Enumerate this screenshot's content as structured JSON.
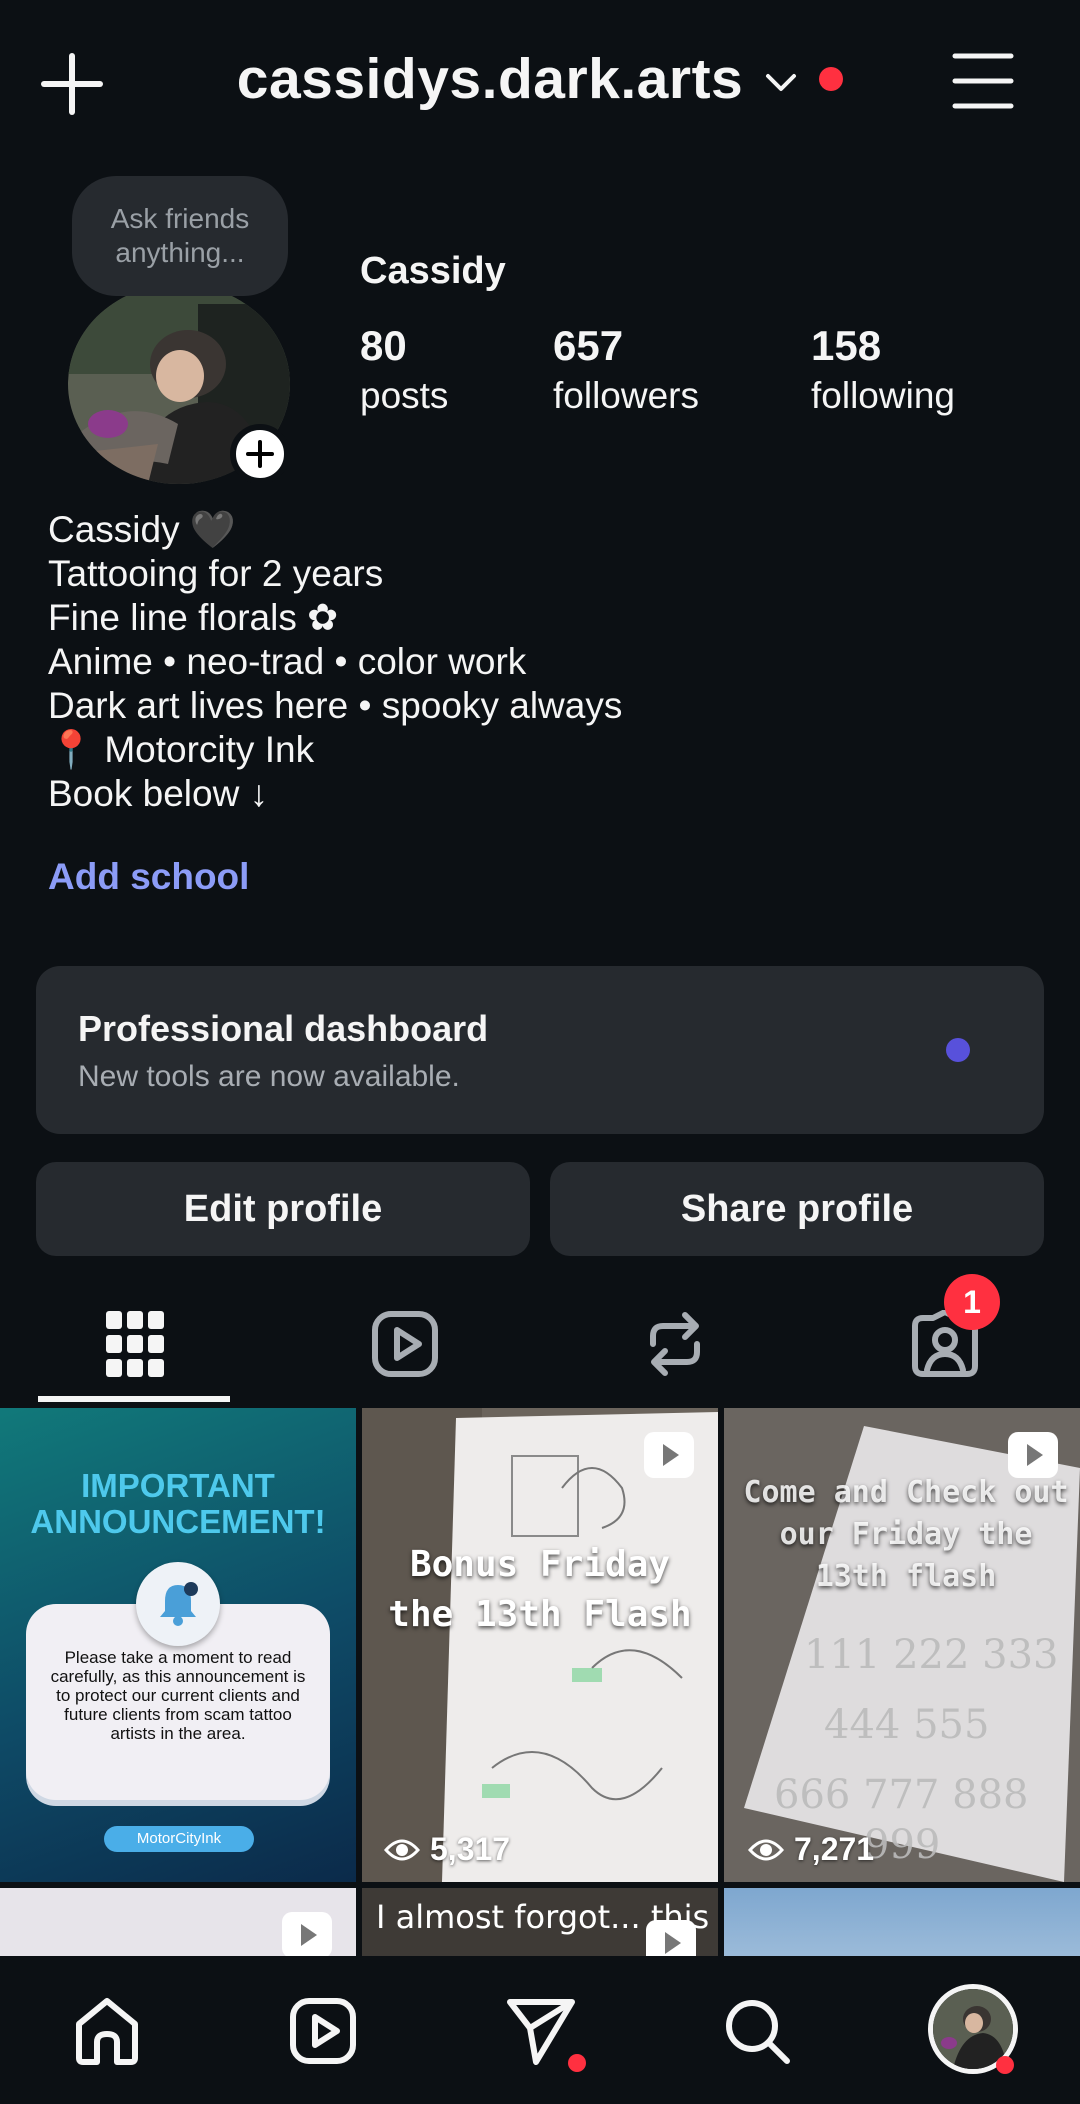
{
  "header": {
    "username": "cassidys.dark.arts"
  },
  "note": {
    "text": "Ask friends anything..."
  },
  "profile": {
    "display_name": "Cassidy",
    "stats": [
      {
        "value": "80",
        "label": "posts"
      },
      {
        "value": "657",
        "label": "followers"
      },
      {
        "value": "158",
        "label": "following"
      }
    ],
    "bio": [
      "Cassidy 🖤",
      "Tattooing for 2 years",
      "Fine line florals ✿",
      "Anime • neo-trad • color work",
      "Dark art lives here • spooky always",
      "📍 Motorcity Ink",
      "Book below ↓"
    ],
    "add_school": "Add school"
  },
  "dashboard": {
    "title": "Professional dashboard",
    "subtitle": "New tools are now available."
  },
  "actions": {
    "edit": "Edit profile",
    "share": "Share profile"
  },
  "tabs": {
    "tagged_badge": "1"
  },
  "posts": [
    {
      "heading": "IMPORTANT ANNOUNCEMENT!",
      "body": "Please take a moment to read carefully, as this announcement is to protect our current clients and future clients from scam tattoo artists in the area.",
      "pill": "MotorCityInk"
    },
    {
      "overlay": "Bonus Friday the 13th Flash",
      "views": "5,317"
    },
    {
      "overlay": "Come and Check out our Friday the 13th flash",
      "views": "7,271"
    },
    {
      "overlay": "I almost forgot... this was the"
    }
  ],
  "colors": {
    "background": "#0c1014",
    "card": "#262a2f",
    "link": "#8c9cf7",
    "notification": "#ff3040",
    "unread": "#5851db"
  },
  "icons": [
    "plus-icon",
    "chevron-down-icon",
    "menu-icon",
    "grid-icon",
    "reels-icon",
    "reposts-icon",
    "tagged-icon",
    "home-icon",
    "send-icon",
    "search-icon"
  ]
}
